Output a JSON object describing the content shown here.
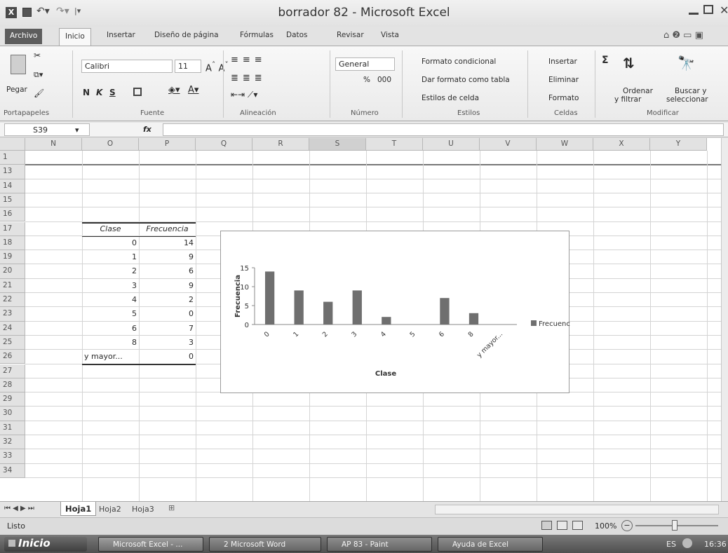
{
  "window": {
    "title": "borrador 82 - Microsoft Excel"
  },
  "tabs": [
    "Archivo",
    "Inicio",
    "Insertar",
    "Diseño de página",
    "Fórmulas",
    "Datos",
    "Revisar",
    "Vista"
  ],
  "ribbon": {
    "clipboard": {
      "paste": "Pegar",
      "label": "Portapapeles"
    },
    "font": {
      "name": "Calibri",
      "size": "11",
      "bold": "N",
      "italic": "K",
      "underline": "S",
      "label": "Fuente"
    },
    "align": {
      "label": "Alineación"
    },
    "number": {
      "format": "General",
      "percent": "%",
      "thousands": "000",
      "label": "Número"
    },
    "styles": {
      "conditional": "Formato condicional",
      "as_table": "Dar formato como tabla",
      "cell_styles": "Estilos de celda",
      "label": "Estilos"
    },
    "cells": {
      "insert": "Insertar",
      "delete": "Eliminar",
      "format": "Formato",
      "label": "Celdas"
    },
    "edit": {
      "sort1": "Ordenar",
      "sort2": "y filtrar",
      "find1": "Buscar y",
      "find2": "seleccionar",
      "label": "Modificar"
    }
  },
  "formula_bar": {
    "name_box": "S39",
    "fx": "fx",
    "value": ""
  },
  "columns": [
    "N",
    "O",
    "P",
    "Q",
    "R",
    "S",
    "T",
    "U",
    "V",
    "W",
    "X",
    "Y"
  ],
  "rows": [
    "1",
    "13",
    "14",
    "15",
    "16",
    "17",
    "18",
    "19",
    "20",
    "21",
    "22",
    "23",
    "24",
    "25",
    "26",
    "27",
    "28",
    "29",
    "30",
    "31",
    "32",
    "33",
    "34"
  ],
  "table": {
    "headers": [
      "Clase",
      "Frecuencia"
    ],
    "data": [
      [
        "0",
        "14"
      ],
      [
        "1",
        "9"
      ],
      [
        "2",
        "6"
      ],
      [
        "3",
        "9"
      ],
      [
        "4",
        "2"
      ],
      [
        "5",
        "0"
      ],
      [
        "6",
        "7"
      ],
      [
        "8",
        "3"
      ],
      [
        "y mayor...",
        "0"
      ]
    ]
  },
  "chart_data": {
    "type": "bar",
    "categories": [
      "0",
      "1",
      "2",
      "3",
      "4",
      "5",
      "6",
      "8",
      "y mayor..."
    ],
    "series": [
      {
        "name": "Frecuencia",
        "values": [
          14,
          9,
          6,
          9,
          2,
          0,
          7,
          3,
          0
        ]
      }
    ],
    "xlabel": "Clase",
    "ylabel": "Frecuencia",
    "yticks": [
      "0",
      "5",
      "10",
      "15"
    ],
    "ylim": [
      0,
      15
    ],
    "legend": "right",
    "grid": false,
    "bar_color": "#6f6f6f"
  },
  "sheet_tabs": [
    "Hoja1",
    "Hoja2",
    "Hoja3"
  ],
  "status": {
    "ready": "Listo",
    "zoom": "100%"
  },
  "taskbar": {
    "start": "Inicio",
    "items": [
      "Microsoft Excel - ...",
      "2 Microsoft Word",
      "AP 83 - Paint",
      "Ayuda de Excel"
    ],
    "lang": "ES",
    "time": "16:36"
  }
}
